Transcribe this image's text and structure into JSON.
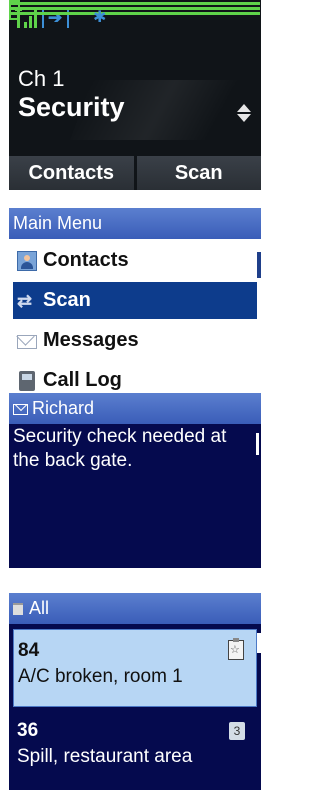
{
  "home": {
    "channel_label": "Ch 1",
    "channel_name": "Security",
    "softkeys": [
      "Contacts",
      "Scan"
    ],
    "status_icons": [
      "signal-icon",
      "transfer-arrow-icon",
      "battery-icon",
      "bluetooth-icon"
    ],
    "accent_color": "#5fd34a"
  },
  "menu": {
    "title": "Main Menu",
    "items": [
      {
        "label": "Contacts",
        "icon": "contact-icon"
      },
      {
        "label": "Scan",
        "icon": "scan-icon",
        "selected": true
      },
      {
        "label": "Messages",
        "icon": "envelope-icon"
      },
      {
        "label": "Call Log",
        "icon": "phone-icon"
      }
    ],
    "title_color": "#3a5db8",
    "selected_color": "#0d3c8c"
  },
  "message": {
    "title": "Richard",
    "body": "Security check needed at the back gate.",
    "bg_color": "#050a4e"
  },
  "list": {
    "title": "All",
    "items": [
      {
        "number": "84",
        "text": "A/C broken, room 1",
        "icon": "clipboard-icon",
        "selected": true
      },
      {
        "number": "36",
        "text": "Spill, restaurant area",
        "icon": "number-badge-icon",
        "badge": "3"
      }
    ]
  }
}
